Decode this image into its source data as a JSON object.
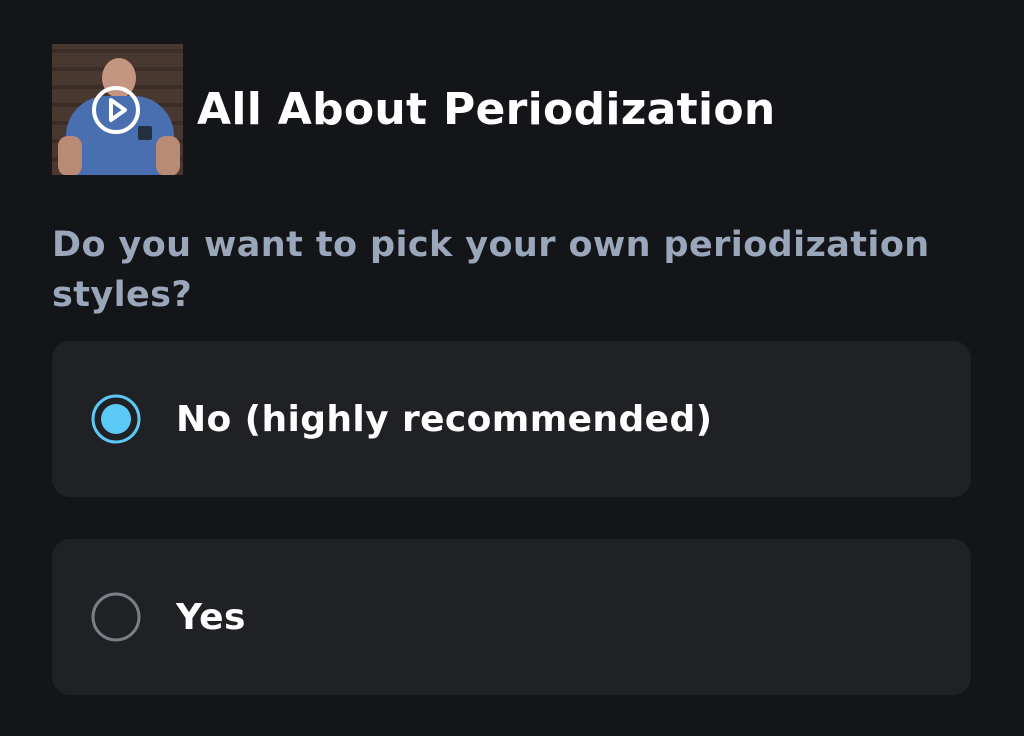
{
  "video": {
    "title": "All About Periodization",
    "thumbnail_icon": "play-circle-icon"
  },
  "question": {
    "text": "Do you want to pick your own periodization styles?"
  },
  "options": [
    {
      "label": "No (highly recommended)",
      "selected": true
    },
    {
      "label": "Yes",
      "selected": false
    }
  ],
  "colors": {
    "background": "#141518",
    "card": "#202124",
    "question_text": "#9aa6b9",
    "radio_selected": "#5bc8f5",
    "radio_unselected_border": "#7b7e86"
  }
}
